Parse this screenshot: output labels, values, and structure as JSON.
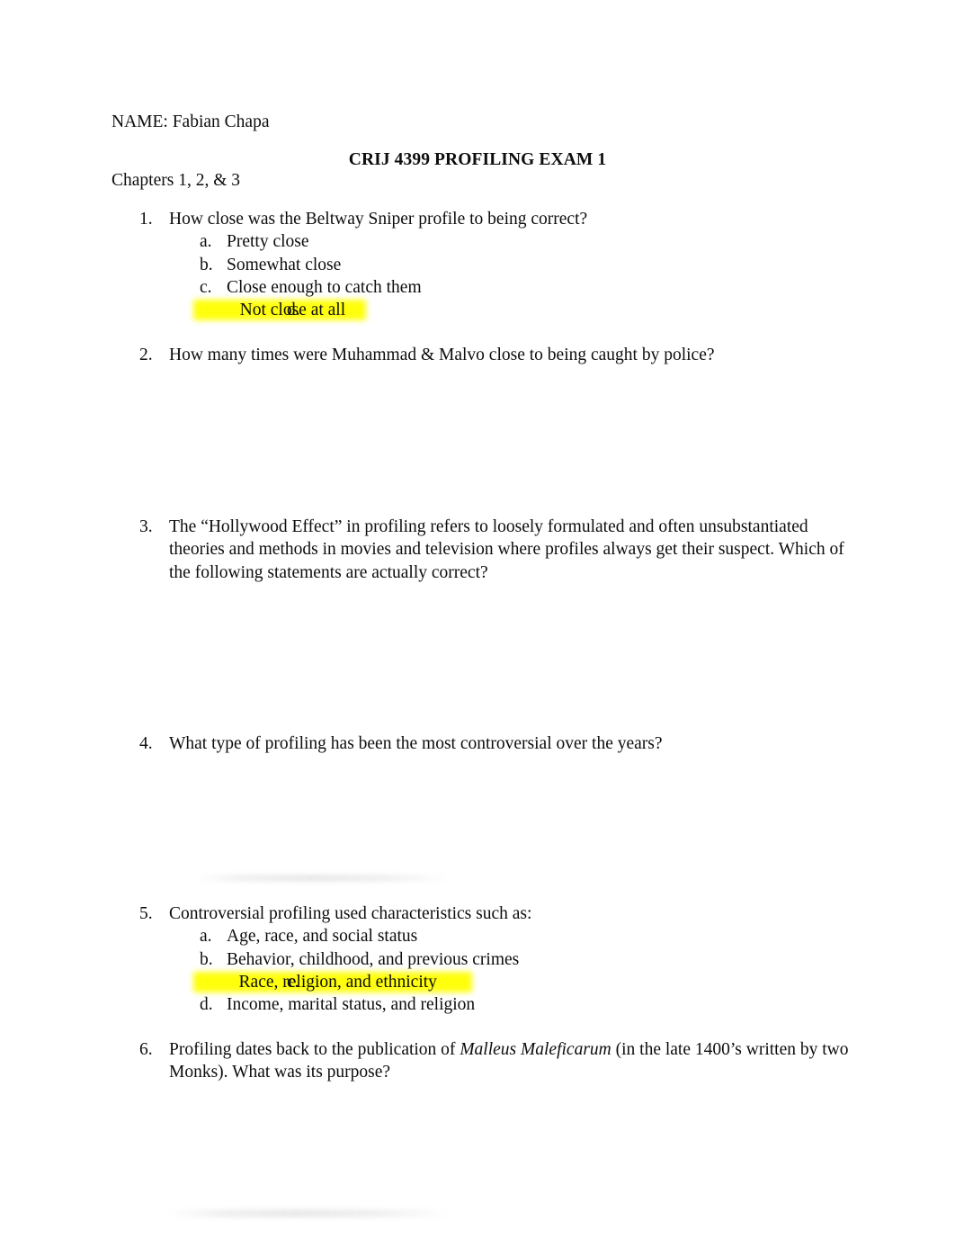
{
  "header": {
    "name_line": "NAME: Fabian Chapa",
    "exam_title": "CRIJ 4399 PROFILING EXAM 1",
    "chapters_line": "Chapters 1, 2, & 3"
  },
  "highlight_color": "#ffff00",
  "questions": [
    {
      "number": "1.",
      "text": "How close was the Beltway Sniper profile to being correct?",
      "options": [
        {
          "letter": "a.",
          "text": "Pretty close",
          "highlighted": false
        },
        {
          "letter": "b.",
          "text": "Somewhat close",
          "highlighted": false
        },
        {
          "letter": "c.",
          "text": "Close enough to catch them",
          "highlighted": false
        },
        {
          "letter": "d.",
          "text": "Not close at all",
          "highlighted": true
        }
      ]
    },
    {
      "number": "2.",
      "text": "How many times were Muhammad & Malvo close to being caught by police?",
      "options": []
    },
    {
      "number": "3.",
      "text": "The “Hollywood Effect” in profiling refers to loosely formulated and often unsubstantiated theories and methods in movies and television where profiles always get their suspect. Which of the following statements are actually correct?",
      "options": []
    },
    {
      "number": "4.",
      "text": "What type of profiling has been the most controversial over the years?",
      "options": []
    },
    {
      "number": "5.",
      "text": "Controversial profiling used characteristics such as:",
      "options": [
        {
          "letter": "a.",
          "text": "Age, race, and social status",
          "highlighted": false
        },
        {
          "letter": "b.",
          "text": "Behavior, childhood, and previous crimes",
          "highlighted": false
        },
        {
          "letter": "c.",
          "text": "Race, religion, and ethnicity",
          "highlighted": true
        },
        {
          "letter": "d.",
          "text": "Income, marital status, and religion",
          "highlighted": false
        }
      ]
    },
    {
      "number": "6.",
      "text_parts": [
        {
          "text": "Profiling dates back to the publication of ",
          "italic": false
        },
        {
          "text": "Malleus Maleficarum",
          "italic": true
        },
        {
          "text": " (in the late 1400’s written by two Monks). What was its purpose?",
          "italic": false
        }
      ],
      "options": []
    }
  ]
}
